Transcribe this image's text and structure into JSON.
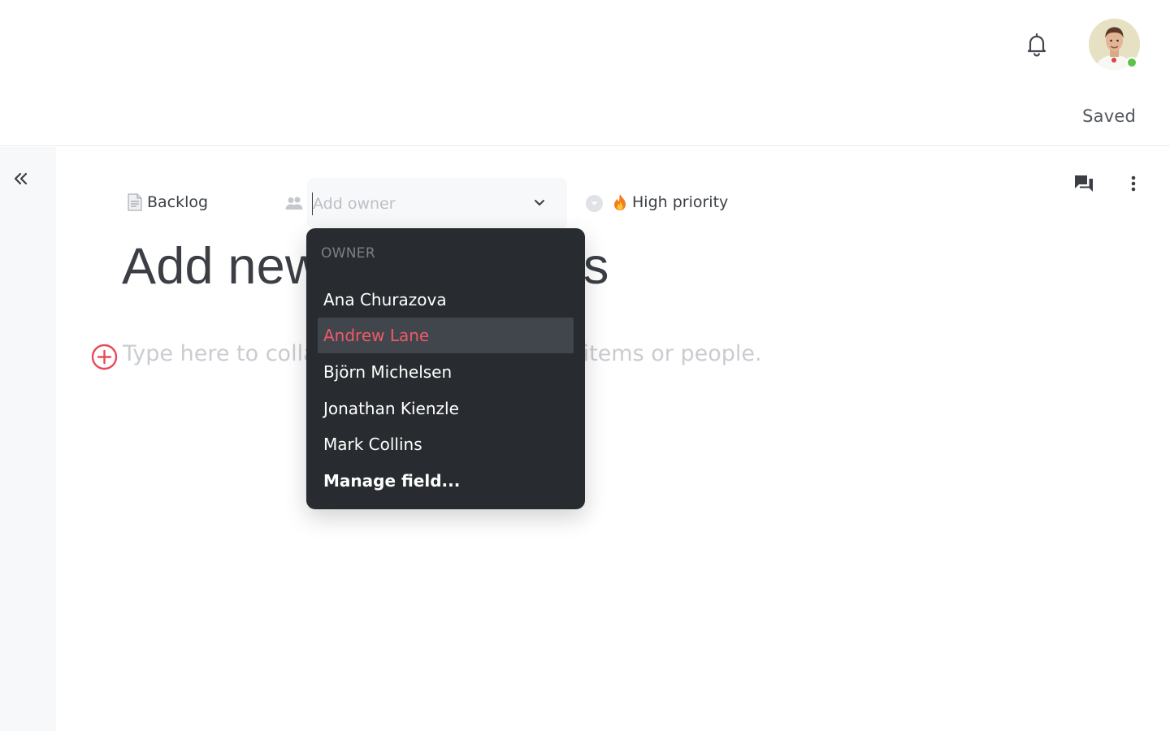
{
  "header": {
    "saved_status": "Saved"
  },
  "properties": {
    "status_label": "Backlog",
    "owner_placeholder": "Add owner",
    "priority_label": "High priority"
  },
  "document": {
    "title": "Add new notifications",
    "body_placeholder": "Type here to collaborate. Use @ to link to items or people."
  },
  "owner_dropdown": {
    "header": "OWNER",
    "options": [
      {
        "label": "Ana Churazova",
        "selected": false
      },
      {
        "label": "Andrew Lane",
        "selected": true
      },
      {
        "label": "Björn Michelsen",
        "selected": false
      },
      {
        "label": "Jonathan Kienzle",
        "selected": false
      },
      {
        "label": "Mark Collins",
        "selected": false
      }
    ],
    "manage_label": "Manage field..."
  },
  "colors": {
    "accent_red": "#ee5a67",
    "presence_green": "#5bc34d",
    "dropdown_bg": "#282b2f",
    "dropdown_selected_bg": "#41464d"
  },
  "icons": {
    "bell": "bell-icon",
    "avatar": "user-avatar",
    "collapse": "double-chevron-left-icon",
    "comments": "comments-icon",
    "more": "vertical-dots-icon",
    "status": "document-icon",
    "owner": "people-icon",
    "chevron": "chevron-down-icon",
    "priority": "fire-icon",
    "add_block": "plus-circle-icon"
  }
}
